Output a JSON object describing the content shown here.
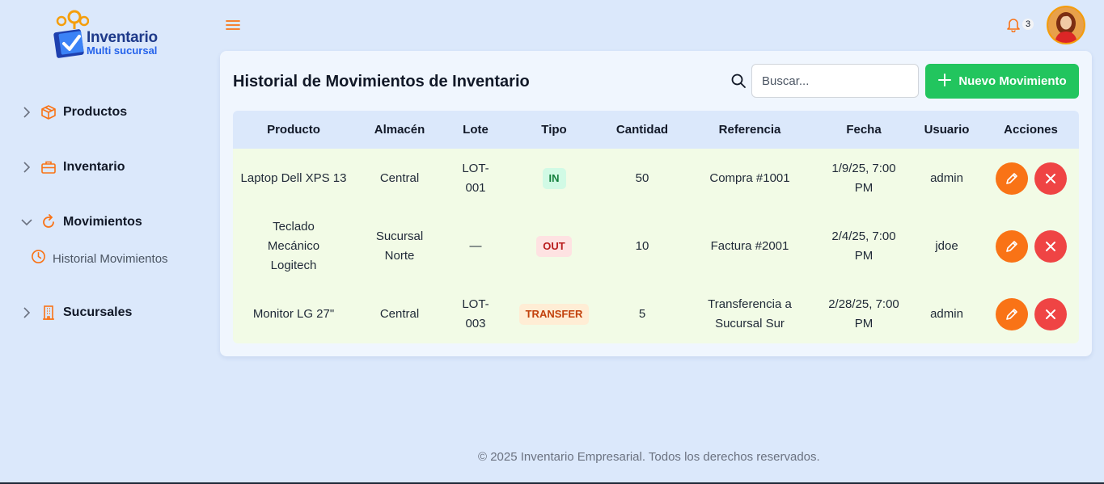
{
  "brand": {
    "name": "Inventario",
    "subtitle": "Multi sucursal"
  },
  "sidebar": {
    "items": [
      {
        "label": "Productos",
        "icon": "box-icon",
        "expanded": false
      },
      {
        "label": "Inventario",
        "icon": "briefcase-icon",
        "expanded": false
      },
      {
        "label": "Movimientos",
        "icon": "refresh-icon",
        "expanded": true,
        "children": [
          {
            "label": "Historial Movimientos",
            "icon": "clock-icon"
          }
        ]
      },
      {
        "label": "Sucursales",
        "icon": "building-icon",
        "expanded": false
      }
    ]
  },
  "header": {
    "notification_count": "3"
  },
  "main": {
    "title": "Historial de Movimientos de Inventario",
    "search": {
      "placeholder": "Buscar...",
      "value": ""
    },
    "new_button_label": "Nuevo Movimiento",
    "table": {
      "columns": [
        "Producto",
        "Almacén",
        "Lote",
        "Tipo",
        "Cantidad",
        "Referencia",
        "Fecha",
        "Usuario",
        "Acciones"
      ],
      "rows": [
        {
          "producto": "Laptop Dell XPS 13",
          "almacen": "Central",
          "lote": "LOT-001",
          "tipo": "IN",
          "cantidad": "50",
          "referencia": "Compra #1001",
          "fecha": "1/9/25, 7:00 PM",
          "usuario": "admin"
        },
        {
          "producto": "Teclado Mecánico Logitech",
          "almacen": "Sucursal Norte",
          "lote": "—",
          "tipo": "OUT",
          "cantidad": "10",
          "referencia": "Factura #2001",
          "fecha": "2/4/25, 7:00 PM",
          "usuario": "jdoe"
        },
        {
          "producto": "Monitor LG 27\"",
          "almacen": "Central",
          "lote": "LOT-003",
          "tipo": "TRANSFER",
          "cantidad": "5",
          "referencia": "Transferencia a Sucursal Sur",
          "fecha": "2/28/25, 7:00 PM",
          "usuario": "admin"
        }
      ]
    }
  },
  "footer": {
    "text": "© 2025 Inventario Empresarial. Todos los derechos reservados."
  },
  "colors": {
    "accent": "#f97316",
    "success": "#22c55e",
    "danger": "#ef4444",
    "brand_dark": "#1e3a8a",
    "background": "#dbe8fb"
  }
}
